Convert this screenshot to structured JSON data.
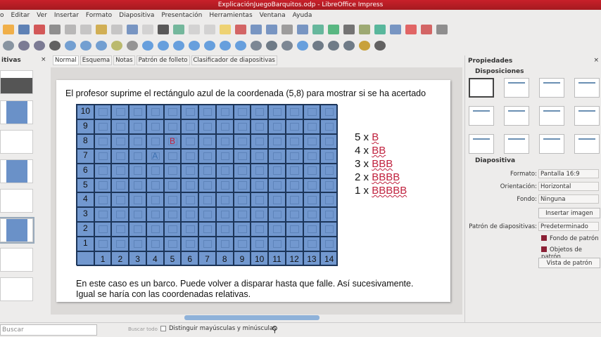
{
  "window": {
    "title": "ExplicaciónJuegoBarquitos.odp - LibreOffice Impress"
  },
  "menu": [
    "o",
    "Editar",
    "Ver",
    "Insertar",
    "Formato",
    "Diapositiva",
    "Presentación",
    "Herramientas",
    "Ventana",
    "Ayuda"
  ],
  "left_panel": {
    "title": "itivas",
    "close": "×"
  },
  "tabs": [
    "Normal",
    "Esquema",
    "Notas",
    "Patrón de folleto",
    "Clasificador de diapositivas"
  ],
  "slide": {
    "title": "El profesor suprime el rectángulo azul de la coordenada (5,8) para mostrar si se ha acertado",
    "grid": {
      "rows": [
        "10",
        "9",
        "8",
        "7",
        "6",
        "5",
        "4",
        "3",
        "2",
        "1"
      ],
      "cols": [
        "1",
        "2",
        "3",
        "4",
        "5",
        "6",
        "7",
        "8",
        "9",
        "10",
        "11",
        "12",
        "13",
        "14"
      ],
      "marks": [
        {
          "col": 5,
          "row": 8,
          "text": "B",
          "color": "#c0223e"
        },
        {
          "col": 4,
          "row": 7,
          "text": "A",
          "color": "#3b6fb0"
        }
      ]
    },
    "fleet": [
      {
        "n": "5 x ",
        "ships": "B"
      },
      {
        "n": "4 x ",
        "ships": "BB"
      },
      {
        "n": "3 x ",
        "ships": "BBB"
      },
      {
        "n": "2 x ",
        "ships": "BBBB"
      },
      {
        "n": "1 x ",
        "ships": "BBBBB"
      }
    ],
    "note_line1": "En este caso es un barco. Puede volver a disparar hasta que falle. Así sucesivamente.",
    "note_line2": "Igual se haría con las coordenadas relativas."
  },
  "properties": {
    "title": "Propiedades",
    "close": "×",
    "layouts_section": "Disposiciones",
    "slide_section": "Diapositiva",
    "format_label": "Formato:",
    "format_value": "Pantalla 16:9",
    "orientation_label": "Orientación:",
    "orientation_value": "Horizontal",
    "background_label": "Fondo:",
    "background_value": "Ninguna",
    "insert_image": "Insertar imagen",
    "master_label": "Patrón de diapositivas:",
    "master_value": "Predeterminado",
    "master_background": "Fondo de patrón",
    "master_objects": "Objetos de patrón",
    "master_view": "Vista de patrón"
  },
  "findbar": {
    "placeholder": "Buscar",
    "find_all": "Buscar todo",
    "match_case": "Distinguir mayúsculas y minúsculas"
  },
  "colors": {
    "accent": "#c8202a",
    "grid": "#7298cf",
    "grid_lines": "#1c3559"
  }
}
